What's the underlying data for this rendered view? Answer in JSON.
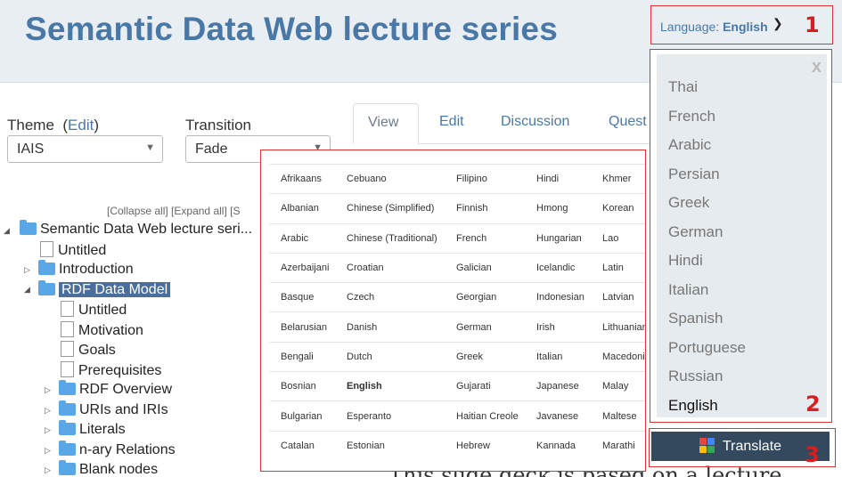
{
  "header": {
    "title": "Semantic Data Web lecture series"
  },
  "language_selector": {
    "label": "Language:",
    "value": "English",
    "chevron": "chevron-down-icon"
  },
  "markers": [
    "1",
    "2",
    "3"
  ],
  "theme": {
    "label": "Theme",
    "edit": "(Edit)",
    "edit_link": "Edit",
    "value": "IAIS"
  },
  "transition": {
    "label": "Transition",
    "value": "Fade"
  },
  "tabs": [
    "View",
    "Edit",
    "Discussion",
    "Quest"
  ],
  "tree_controls": {
    "collapse": "Collapse all",
    "expand": "Expand all",
    "s": "S"
  },
  "tree": [
    {
      "label": "Semantic Data Web lecture seri...",
      "type": "folder"
    },
    {
      "label": "Untitled",
      "type": "page"
    },
    {
      "label": "Introduction",
      "type": "folder"
    },
    {
      "label": "RDF Data Model",
      "type": "folder",
      "selected": true
    },
    {
      "label": "Untitled",
      "type": "page"
    },
    {
      "label": "Motivation",
      "type": "page"
    },
    {
      "label": "Goals",
      "type": "page"
    },
    {
      "label": "Prerequisites",
      "type": "page"
    },
    {
      "label": "RDF Overview",
      "type": "folder"
    },
    {
      "label": "URIs and IRIs",
      "type": "folder"
    },
    {
      "label": "Literals",
      "type": "folder"
    },
    {
      "label": "n-ary Relations",
      "type": "folder"
    },
    {
      "label": "Blank nodes",
      "type": "folder"
    }
  ],
  "language_grid": [
    [
      "Afrikaans",
      "Cebuano",
      "Filipino",
      "Hindi",
      "Khmer"
    ],
    [
      "Albanian",
      "Chinese (Simplified)",
      "Finnish",
      "Hmong",
      "Korean"
    ],
    [
      "Arabic",
      "Chinese (Traditional)",
      "French",
      "Hungarian",
      "Lao"
    ],
    [
      "Azerbaijani",
      "Croatian",
      "Galician",
      "Icelandic",
      "Latin"
    ],
    [
      "Basque",
      "Czech",
      "Georgian",
      "Indonesian",
      "Latvian"
    ],
    [
      "Belarusian",
      "Danish",
      "German",
      "Irish",
      "Lithuanian"
    ],
    [
      "Bengali",
      "Dutch",
      "Greek",
      "Italian",
      "Macedoni"
    ],
    [
      "Bosnian",
      "English",
      "Gujarati",
      "Japanese",
      "Malay"
    ],
    [
      "Bulgarian",
      "Esperanto",
      "Haitian Creole",
      "Javanese",
      "Maltese"
    ],
    [
      "Catalan",
      "Estonian",
      "Hebrew",
      "Kannada",
      "Marathi"
    ]
  ],
  "language_list": {
    "close": "x",
    "items": [
      "Thai",
      "French",
      "Arabic",
      "Persian",
      "Greek",
      "German",
      "Hindi",
      "Italian",
      "Spanish",
      "Portuguese",
      "Russian",
      "English"
    ],
    "current": "English"
  },
  "translate_button": {
    "label": "Translate",
    "icon": "google-icon"
  },
  "content_fragment": "This slide deck is based on a lecture",
  "colors": {
    "brand": "#4a78a6",
    "header_bg": "#e9eef3",
    "annotation": "#d81e1e",
    "button": "#34495e",
    "selected": "#4a6f9c"
  }
}
